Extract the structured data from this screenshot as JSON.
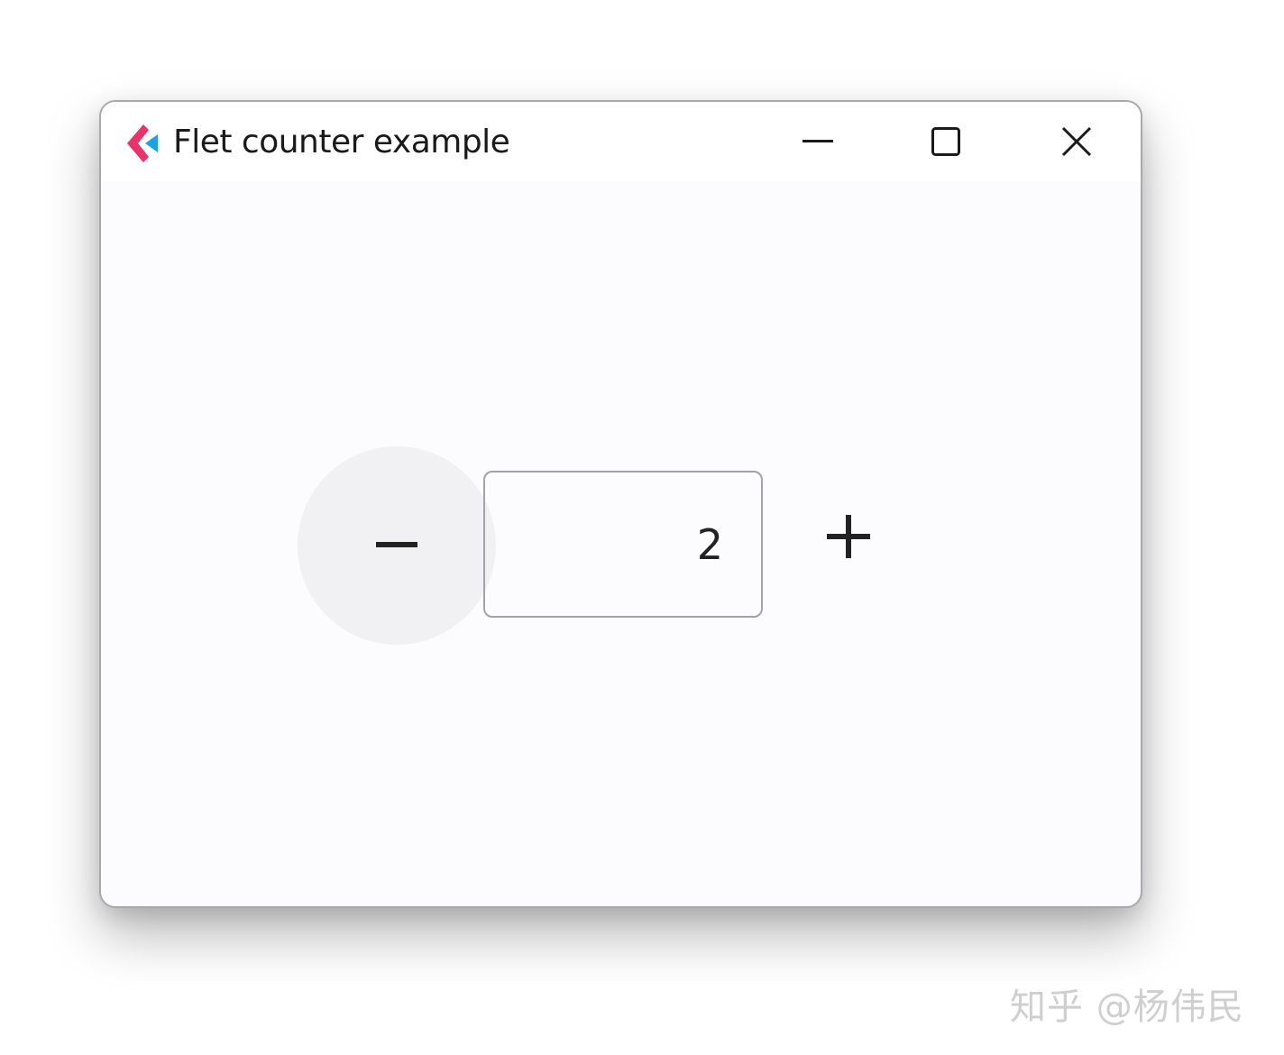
{
  "window": {
    "title": "Flet counter example",
    "app_icon": "flet-logo-icon",
    "controls": {
      "minimize": "minimize-icon",
      "maximize": "maximize-icon",
      "close": "close-icon"
    }
  },
  "counter": {
    "value": "2",
    "decrement_icon": "minus-icon",
    "increment_icon": "plus-icon"
  },
  "watermark": {
    "text": "知乎 @杨伟民"
  },
  "colors": {
    "logo_pink": "#e8336d",
    "logo_blue": "#1aa3e0",
    "window_bg": "#fcfcfe",
    "button_hover_bg": "#f1f1f4",
    "border": "#a3a3a7",
    "text": "#1a1a1a"
  }
}
